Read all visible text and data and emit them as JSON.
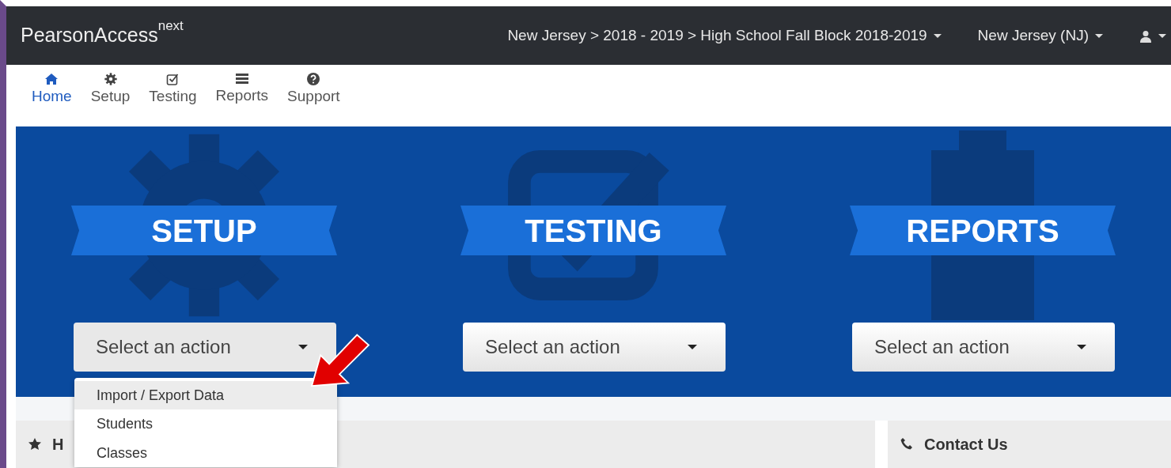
{
  "brand": "PearsonAccess$^{next}$",
  "top_menus": [
    {
      "kind": "text",
      "label": "New Jersey > 2018 - 2019 > High School Fall Block 2018-2019"
    },
    {
      "kind": "text",
      "label": "New Jersey (NJ)"
    },
    {
      "kind": "user"
    }
  ],
  "nav": [
    {
      "label": "Home",
      "kind": "home",
      "selected": true
    },
    {
      "label": "Setup",
      "kind": "gear",
      "selected": false
    },
    {
      "label": "Testing",
      "kind": "check",
      "selected": false
    },
    {
      "label": "Reports",
      "kind": "list",
      "selected": false
    },
    {
      "label": "Support",
      "kind": "question",
      "selected": false
    }
  ],
  "hero": [
    {
      "title": "SETUP",
      "kind": "gear",
      "select": {
        "placeholder": "Select an action",
        "expanded": true,
        "options": [
          {
            "label": "Import / Export Data",
            "highlighted": true
          },
          {
            "label": "Students",
            "highlighted": false
          },
          {
            "label": "Classes",
            "highlighted": false
          }
        ]
      }
    },
    {
      "title": "TESTING",
      "kind": "check",
      "select": {
        "placeholder": "Select an action",
        "expanded": false
      }
    },
    {
      "title": "REPORTS",
      "kind": "clipboard",
      "select": {
        "placeholder": "Select an action",
        "expanded": false
      }
    }
  ],
  "panels": [
    {
      "kind": "star",
      "title": "H"
    },
    {
      "kind": "phone",
      "title": "Contact Us"
    }
  ],
  "annotation": {
    "kind": "arrow"
  }
}
